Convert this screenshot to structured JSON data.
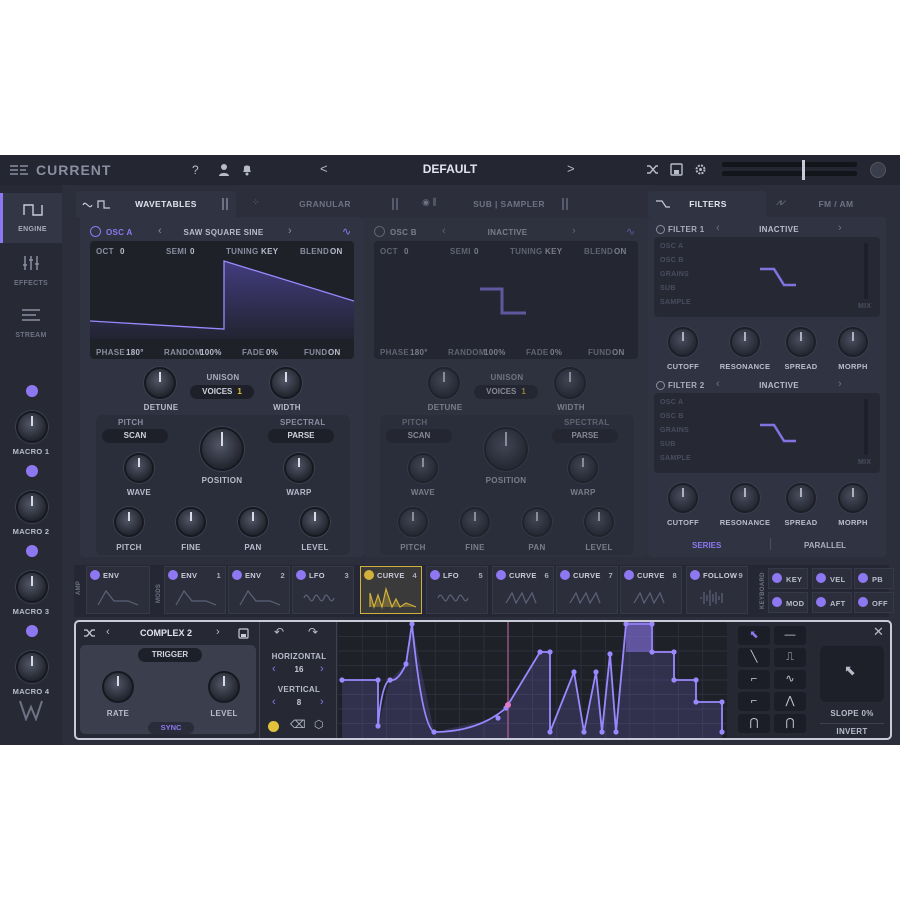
{
  "topbar": {
    "brand": "CURRENT",
    "preset": "DEFAULT",
    "help": "?",
    "prev": "<",
    "next": ">"
  },
  "sidebar": {
    "items": [
      {
        "label": "ENGINE"
      },
      {
        "label": "EFFECTS"
      },
      {
        "label": "STREAM"
      }
    ],
    "macros": [
      "MACRO 1",
      "MACRO 2",
      "MACRO 3",
      "MACRO 4"
    ]
  },
  "tabs": {
    "wavetables": "WAVETABLES",
    "granular": "GRANULAR",
    "sub_sampler": "SUB | SAMPLER",
    "filters": "FILTERS",
    "fm_am": "FM / AM"
  },
  "osc_a": {
    "title": "OSC A",
    "wave": "SAW SQUARE SINE",
    "oct_l": "OCT",
    "oct": "0",
    "semi_l": "SEMI",
    "semi": "0",
    "tuning_l": "TUNING",
    "tuning": "KEY",
    "blend_l": "BLEND",
    "blend": "ON",
    "phase_l": "PHASE",
    "phase": "180°",
    "random_l": "RANDOM",
    "random": "100%",
    "fade_l": "FADE",
    "fade": "0%",
    "fund_l": "FUND",
    "fund": "ON",
    "detune": "DETUNE",
    "unison": "UNISON",
    "voices_l": "VOICES",
    "voices": "1",
    "width": "WIDTH",
    "pitch_hdr": "PITCH",
    "scan": "SCAN",
    "spectral": "SPECTRAL",
    "parse": "PARSE",
    "wave_k": "WAVE",
    "position": "POSITION",
    "warp": "WARP",
    "pitch": "PITCH",
    "fine": "FINE",
    "pan": "PAN",
    "level": "LEVEL"
  },
  "osc_b": {
    "title": "OSC B",
    "wave": "INACTIVE",
    "oct_l": "OCT",
    "oct": "0",
    "semi_l": "SEMI",
    "semi": "0",
    "tuning_l": "TUNING",
    "tuning": "KEY",
    "blend_l": "BLEND",
    "blend": "ON",
    "phase_l": "PHASE",
    "phase": "180°",
    "random_l": "RANDOM",
    "random": "100%",
    "fade_l": "FADE",
    "fade": "0%",
    "fund_l": "FUND",
    "fund": "ON",
    "detune": "DETUNE",
    "unison": "UNISON",
    "voices_l": "VOICES",
    "voices": "1",
    "width": "WIDTH",
    "pitch_hdr": "PITCH",
    "scan": "SCAN",
    "spectral": "SPECTRAL",
    "parse": "PARSE",
    "wave_k": "WAVE",
    "position": "POSITION",
    "warp": "WARP",
    "pitch": "PITCH",
    "fine": "FINE",
    "pan": "PAN",
    "level": "LEVEL"
  },
  "filter1": {
    "title": "FILTER 1",
    "state": "INACTIVE",
    "sources": [
      "OSC A",
      "OSC B",
      "GRAINS",
      "SUB",
      "SAMPLE"
    ],
    "mix": "MIX",
    "cutoff": "CUTOFF",
    "resonance": "RESONANCE",
    "spread": "SPREAD",
    "morph": "MORPH"
  },
  "filter2": {
    "title": "FILTER 2",
    "state": "INACTIVE",
    "sources": [
      "OSC A",
      "OSC B",
      "GRAINS",
      "SUB",
      "SAMPLE"
    ],
    "mix": "MIX",
    "cutoff": "CUTOFF",
    "resonance": "RESONANCE",
    "spread": "SPREAD",
    "morph": "MORPH"
  },
  "routing": {
    "series": "SERIES",
    "parallel": "PARALLEL"
  },
  "mods": {
    "amp": "AMP",
    "mods": "MODS",
    "keyboard": "KEYBOARD",
    "slots": [
      {
        "name": "ENV",
        "num": ""
      },
      {
        "name": "ENV",
        "num": "1"
      },
      {
        "name": "ENV",
        "num": "2"
      },
      {
        "name": "LFO",
        "num": "3"
      },
      {
        "name": "CURVE",
        "num": "4"
      },
      {
        "name": "LFO",
        "num": "5"
      },
      {
        "name": "CURVE",
        "num": "6"
      },
      {
        "name": "CURVE",
        "num": "7"
      },
      {
        "name": "CURVE",
        "num": "8"
      },
      {
        "name": "FOLLOW",
        "num": "9"
      }
    ],
    "kb": [
      "KEY",
      "VEL",
      "PB",
      "MOD",
      "AFT",
      "OFF"
    ]
  },
  "editor": {
    "preset": "COMPLEX 2",
    "trigger": "TRIGGER",
    "rate": "RATE",
    "level": "LEVEL",
    "sync": "SYNC",
    "horizontal_l": "HORIZONTAL",
    "horizontal": "16",
    "vertical_l": "VERTICAL",
    "vertical": "8",
    "slope_l": "SLOPE",
    "slope": "0%",
    "invert": "INVERT"
  },
  "colors": {
    "accent": "#8d78f2",
    "panel": "#2c2f3b",
    "active_slot": "#d2b03c"
  }
}
